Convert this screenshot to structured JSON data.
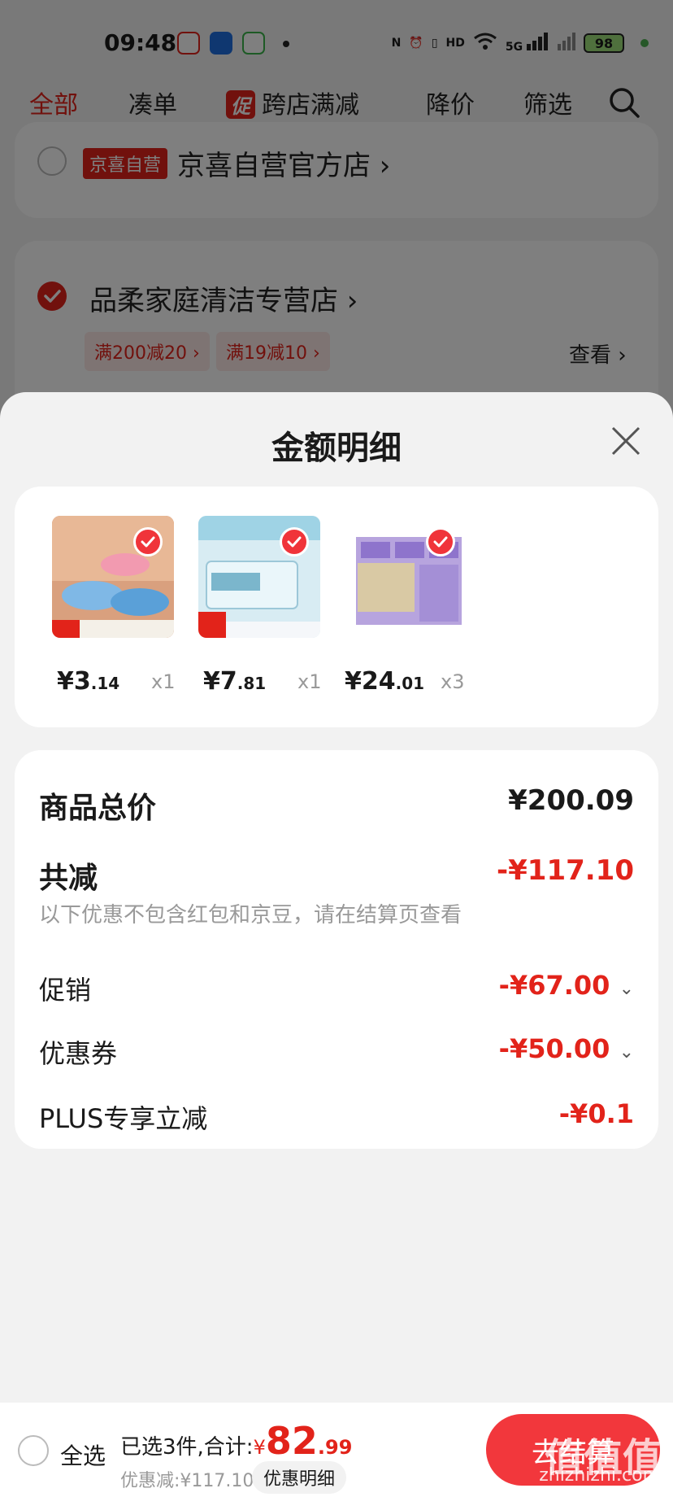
{
  "status": {
    "time": "09:48",
    "network": "5G",
    "battery": "98"
  },
  "tabs": [
    {
      "label": "全部"
    },
    {
      "label": "凑单"
    },
    {
      "tag": "促",
      "label": "跨店满减"
    },
    {
      "label": "降价"
    },
    {
      "label": "筛选"
    }
  ],
  "stores": [
    {
      "badge": "京喜自营",
      "name": "京喜自营官方店"
    },
    {
      "name": "品柔家庭清洁专营店",
      "coupons": [
        "满200减20",
        "满19减10"
      ],
      "view": "查看"
    }
  ],
  "sheet": {
    "title": "金额明细",
    "products": [
      {
        "price_int": "¥3",
        "price_dec": ".14",
        "qty": "x1"
      },
      {
        "price_int": "¥7",
        "price_dec": ".81",
        "qty": "x1"
      },
      {
        "price_int": "¥24",
        "price_dec": ".01",
        "qty": "x3"
      }
    ],
    "summary": {
      "goods_total_label": "商品总价",
      "goods_total": "¥200.09",
      "total_reduce_label": "共减",
      "total_reduce": "-¥117.10",
      "hint": "以下优惠不包含红包和京豆，请在结算页查看",
      "rows": [
        {
          "label": "促销",
          "value": "-¥67.00"
        },
        {
          "label": "优惠券",
          "value": "-¥50.00"
        },
        {
          "label": "PLUS专享立减",
          "value": "-¥0.1"
        }
      ]
    }
  },
  "bottom": {
    "select_all": "全选",
    "selected": "已选3件,合计:",
    "currency": "¥",
    "total_int": "82",
    "total_dec": ".99",
    "discount": "优惠减:¥117.10",
    "detail": "优惠明细",
    "checkout": "去结算"
  },
  "watermark": "zhizhizhi.com",
  "watermark_big": "值值值",
  "colors": {
    "accent": "#e2231a",
    "checkout": "#f2373c"
  }
}
